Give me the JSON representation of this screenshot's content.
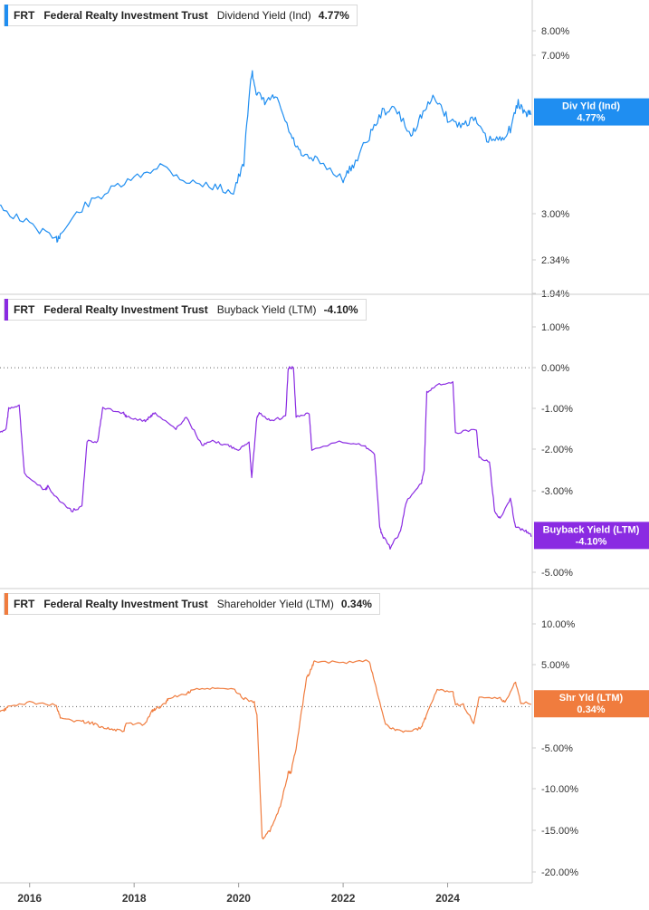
{
  "chart_data": [
    {
      "type": "line",
      "ticker": "FRT",
      "company": "Federal Realty Investment Trust",
      "metric": "Dividend Yield (Ind)",
      "current_value": "4.77%",
      "badge_label": "Div Yld (Ind)",
      "badge_value": "4.77%",
      "color": "#1f8ef1",
      "y_scale": "log",
      "y_ticks": [
        8.0,
        7.0,
        3.0,
        2.34,
        1.94
      ],
      "y_tick_labels": [
        "8.00%",
        "7.00%",
        "3.00%",
        "2.34%",
        "1.94%"
      ],
      "x": [
        2015.1,
        2015.5,
        2016.0,
        2016.5,
        2016.6,
        2017.0,
        2017.5,
        2018.0,
        2018.5,
        2019.0,
        2019.5,
        2019.9,
        2020.1,
        2020.25,
        2020.35,
        2020.5,
        2020.7,
        2021.0,
        2021.2,
        2021.5,
        2022.0,
        2022.2,
        2022.5,
        2022.75,
        2023.0,
        2023.3,
        2023.5,
        2023.75,
        2024.0,
        2024.25,
        2024.5,
        2024.75,
        2025.0,
        2025.2,
        2025.35,
        2025.5,
        2025.6
      ],
      "values": [
        3.0,
        2.7,
        2.5,
        2.25,
        2.35,
        2.75,
        3.05,
        3.3,
        3.6,
        3.25,
        3.15,
        3.05,
        3.6,
        6.4,
        5.6,
        5.3,
        5.5,
        4.3,
        3.8,
        3.7,
        3.3,
        3.6,
        4.3,
        5.0,
        5.1,
        4.3,
        4.9,
        5.5,
        4.8,
        4.6,
        4.8,
        4.2,
        4.2,
        4.5,
        5.3,
        4.9,
        5.0
      ]
    },
    {
      "type": "line",
      "ticker": "FRT",
      "company": "Federal Realty Investment Trust",
      "metric": "Buyback Yield (LTM)",
      "current_value": "-4.10%",
      "badge_label": "Buyback Yield (LTM)",
      "badge_value": "-4.10%",
      "color": "#8a2be2",
      "y_ticks": [
        1,
        0,
        -1,
        -2,
        -3,
        -5
      ],
      "y_tick_labels": [
        "1.00%",
        "0.00%",
        "-1.00%",
        "-2.00%",
        "-3.00%",
        "-5.00%"
      ],
      "zero_line": 0,
      "x": [
        2015.1,
        2015.4,
        2015.55,
        2015.6,
        2015.8,
        2015.9,
        2016.3,
        2016.35,
        2016.6,
        2016.8,
        2017.0,
        2017.1,
        2017.3,
        2017.4,
        2017.8,
        2017.85,
        2018.2,
        2018.3,
        2018.4,
        2018.8,
        2019.0,
        2019.3,
        2019.5,
        2019.8,
        2020.0,
        2020.2,
        2020.25,
        2020.35,
        2020.4,
        2020.6,
        2020.9,
        2020.95,
        2021.05,
        2021.1,
        2021.35,
        2021.4,
        2022.0,
        2022.4,
        2022.6,
        2022.7,
        2022.75,
        2022.9,
        2023.1,
        2023.2,
        2023.5,
        2023.55,
        2023.6,
        2023.8,
        2024.1,
        2024.15,
        2024.55,
        2024.6,
        2024.8,
        2024.9,
        2025.0,
        2025.2,
        2025.3,
        2025.5,
        2025.6
      ],
      "values": [
        -2.0,
        -1.6,
        -1.5,
        -1.0,
        -0.9,
        -2.6,
        -3.0,
        -2.9,
        -3.3,
        -3.5,
        -3.4,
        -1.8,
        -1.8,
        -1.0,
        -1.1,
        -1.2,
        -1.3,
        -1.2,
        -1.1,
        -1.5,
        -1.2,
        -1.9,
        -1.8,
        -1.9,
        -2.0,
        -1.8,
        -2.7,
        -1.2,
        -1.1,
        -1.3,
        -1.2,
        0.0,
        0.0,
        -1.2,
        -1.1,
        -2.0,
        -1.8,
        -1.9,
        -2.1,
        -3.9,
        -4.1,
        -4.4,
        -4.0,
        -3.3,
        -2.8,
        -2.5,
        -0.6,
        -0.4,
        -0.35,
        -1.6,
        -1.5,
        -2.2,
        -2.3,
        -3.5,
        -3.7,
        -3.2,
        -3.9,
        -4.0,
        -4.1
      ]
    },
    {
      "type": "line",
      "ticker": "FRT",
      "company": "Federal Realty Investment Trust",
      "metric": "Shareholder Yield (LTM)",
      "current_value": "0.34%",
      "badge_label": "Shr Yld (LTM)",
      "badge_value": "0.34%",
      "color": "#f07c3e",
      "y_ticks": [
        10,
        5,
        -5,
        -10,
        -15,
        -20
      ],
      "y_tick_labels": [
        "10.00%",
        "5.00%",
        "-5.00%",
        "-10.00%",
        "-15.00%",
        "-20.00%"
      ],
      "zero_line": 0,
      "x": [
        2015.1,
        2015.5,
        2015.6,
        2016.0,
        2016.5,
        2016.6,
        2017.0,
        2017.2,
        2017.4,
        2017.6,
        2017.8,
        2017.85,
        2018.2,
        2018.35,
        2018.4,
        2018.6,
        2018.65,
        2019.0,
        2019.1,
        2019.5,
        2019.9,
        2020.1,
        2020.3,
        2020.35,
        2020.45,
        2020.6,
        2020.8,
        2020.95,
        2021.0,
        2021.1,
        2021.3,
        2021.35,
        2021.45,
        2022.0,
        2022.5,
        2022.6,
        2022.8,
        2022.9,
        2023.1,
        2023.3,
        2023.5,
        2023.6,
        2023.8,
        2024.1,
        2024.15,
        2024.3,
        2024.5,
        2024.6,
        2025.0,
        2025.1,
        2025.3,
        2025.4,
        2025.6
      ],
      "values": [
        -1.0,
        -0.5,
        0.0,
        0.5,
        0.2,
        -1.5,
        -1.8,
        -2.0,
        -2.5,
        -2.8,
        -3.0,
        -2.0,
        -2.2,
        -0.5,
        -0.3,
        0.3,
        1.0,
        1.5,
        2.0,
        2.2,
        2.1,
        1.0,
        0.5,
        -1.0,
        -16.0,
        -15.0,
        -12.0,
        -8.0,
        -8.0,
        -5.0,
        3.5,
        4.0,
        5.5,
        5.3,
        5.5,
        3.0,
        -2.0,
        -2.5,
        -3.0,
        -3.0,
        -2.5,
        -1.0,
        2.0,
        1.8,
        0.3,
        0.2,
        -2.0,
        1.0,
        1.0,
        0.5,
        3.0,
        0.5,
        0.34
      ]
    }
  ],
  "x_axis": {
    "range": [
      2015.0,
      2026.0
    ],
    "ticks": [
      2016,
      2018,
      2020,
      2022,
      2024
    ],
    "tick_labels": [
      "2016",
      "2018",
      "2020",
      "2022",
      "2024"
    ]
  }
}
